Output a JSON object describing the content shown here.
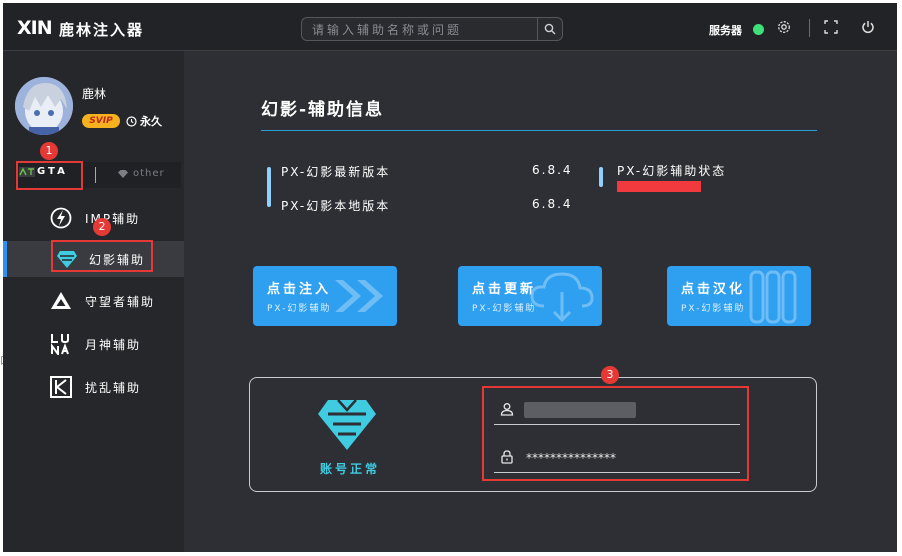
{
  "app": {
    "logo_mark": "XIN",
    "title": "鹿林注入器"
  },
  "search": {
    "placeholder": "请输入辅助名称或问题"
  },
  "header": {
    "server_label": "服务器",
    "server_status_color": "#3ee07a",
    "icons": [
      "settings-icon",
      "fullscreen-icon",
      "power-icon"
    ]
  },
  "user": {
    "name": "鹿林",
    "badge": "SVIP",
    "expiry": "永久"
  },
  "game_tabs": [
    {
      "label": "GTA",
      "active": true
    },
    {
      "label": "other",
      "active": false
    }
  ],
  "menu": [
    {
      "label": "IMP辅助",
      "icon": "lightning-icon",
      "active": false
    },
    {
      "label": "幻影辅助",
      "icon": "phantom-icon",
      "active": true
    },
    {
      "label": "守望者辅助",
      "icon": "triangle-icon",
      "active": false
    },
    {
      "label": "月神辅助",
      "icon": "luna-icon",
      "active": false
    },
    {
      "label": "扰乱辅助",
      "icon": "k-icon",
      "active": false
    }
  ],
  "main": {
    "title": "幻影-辅助信息",
    "info": [
      {
        "label": "PX-幻影最新版本",
        "value": "6.8.4"
      },
      {
        "label": "PX-幻影本地版本",
        "value": "6.8.4"
      }
    ],
    "status_label": "PX-幻影辅助状态",
    "actions": [
      {
        "title": "点击注入",
        "subtitle": "PX-幻影辅助",
        "icon": "arrows-icon"
      },
      {
        "title": "点击更新",
        "subtitle": "PX-幻影辅助",
        "icon": "cloud-download-icon"
      },
      {
        "title": "点击汉化",
        "subtitle": "PX-幻影辅助",
        "icon": "chinese-icon"
      }
    ]
  },
  "account": {
    "status": "账号正常",
    "password_value": "***************"
  },
  "annotations": [
    "1",
    "2",
    "3"
  ],
  "colors": {
    "accent": "#2f9ff0",
    "annotation": "#e53935",
    "status_text": "#3fcbe0"
  }
}
